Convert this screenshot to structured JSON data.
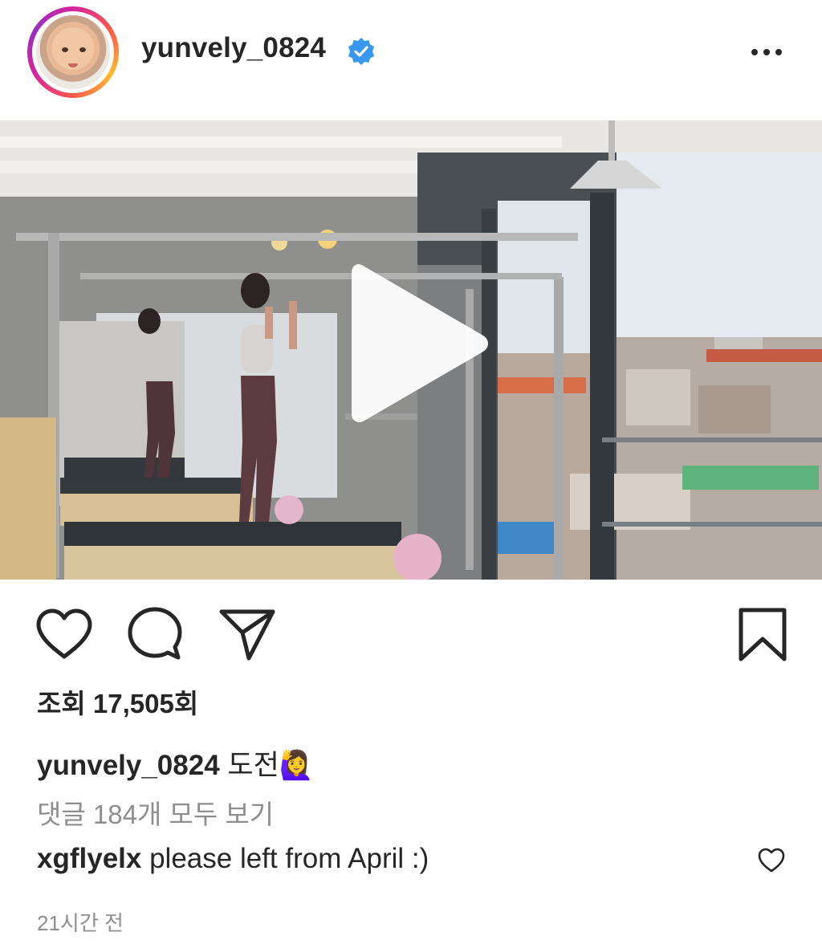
{
  "header": {
    "username": "yunvely_0824",
    "verified_icon": "verified-badge-icon",
    "more_icon": "more-horizontal-icon"
  },
  "video": {
    "play_icon": "play-icon"
  },
  "actions": {
    "like_icon": "heart-icon",
    "comment_icon": "comment-icon",
    "share_icon": "send-icon",
    "save_icon": "bookmark-icon"
  },
  "views": {
    "text": "조회 17,505회"
  },
  "caption": {
    "username": "yunvely_0824",
    "text": "도전🙋‍♀️"
  },
  "comments": {
    "view_all": "댓글 184개 모두 보기",
    "items": [
      {
        "username": "xgflyelx",
        "text": "please left from April :)"
      }
    ]
  },
  "timestamp": "21시간 전",
  "colors": {
    "accent_blue": "#3897f0",
    "text": "#262626",
    "muted": "#8e8e8e"
  }
}
